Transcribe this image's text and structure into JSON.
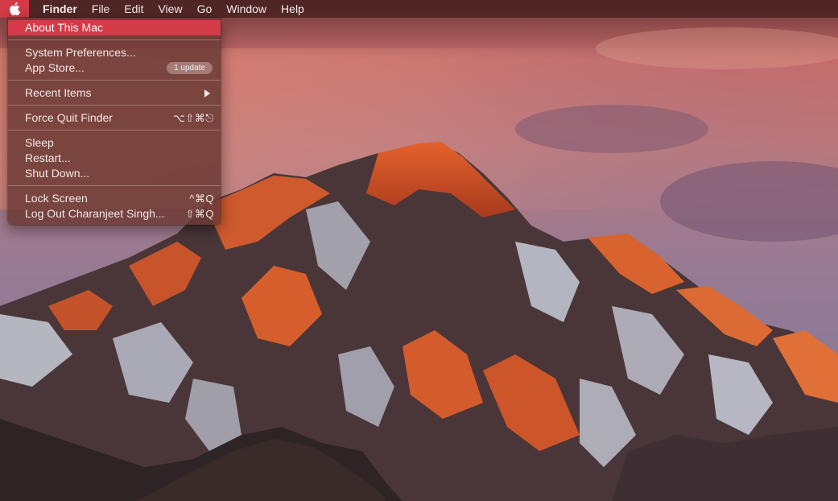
{
  "menubar": {
    "apple_icon": "apple-logo-icon",
    "items": [
      "Finder",
      "File",
      "Edit",
      "View",
      "Go",
      "Window",
      "Help"
    ]
  },
  "apple_menu": {
    "about": "About This Mac",
    "system_preferences": "System Preferences...",
    "app_store": "App Store...",
    "app_store_badge": "1 update",
    "recent_items": "Recent Items",
    "force_quit": "Force Quit Finder",
    "force_quit_shortcut": "⌥⇧⌘⎋",
    "sleep": "Sleep",
    "restart": "Restart...",
    "shut_down": "Shut Down...",
    "lock_screen": "Lock Screen",
    "lock_screen_shortcut": "^⌘Q",
    "log_out": "Log Out Charanjeet Singh...",
    "log_out_shortcut": "⇧⌘Q"
  },
  "colors": {
    "highlight": "#d43b48",
    "menubar": "#482220"
  }
}
